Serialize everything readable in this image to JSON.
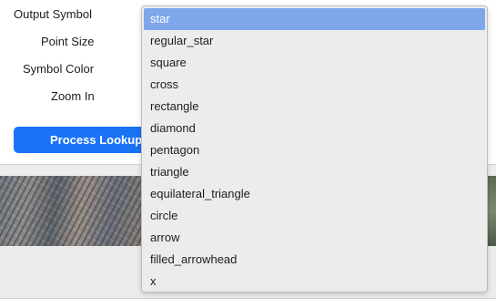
{
  "form": {
    "output_symbol_label": "Output Symbol",
    "point_size_label": "Point Size",
    "symbol_color_label": "Symbol Color",
    "zoom_in_label": "Zoom In",
    "process_button_label": "Process Lookup"
  },
  "dropdown": {
    "selected": "star",
    "options": [
      "star",
      "regular_star",
      "square",
      "cross",
      "rectangle",
      "diamond",
      "pentagon",
      "triangle",
      "equilateral_triangle",
      "circle",
      "arrow",
      "filled_arrowhead",
      "x"
    ]
  },
  "colors": {
    "accent": "#1a73f5",
    "selection": "#7ea6ea"
  }
}
